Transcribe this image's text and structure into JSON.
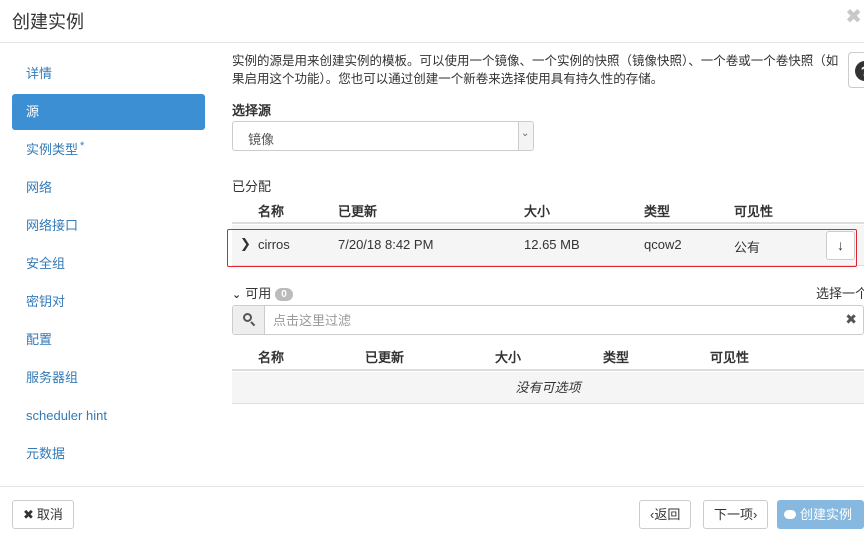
{
  "modal": {
    "title": "创建实例"
  },
  "sidebar": {
    "items": [
      {
        "label": "详情"
      },
      {
        "label": "源"
      },
      {
        "label": "实例类型",
        "required": "*"
      },
      {
        "label": "网络"
      },
      {
        "label": "网络接口"
      },
      {
        "label": "安全组"
      },
      {
        "label": "密钥对"
      },
      {
        "label": "配置"
      },
      {
        "label": "服务器组"
      },
      {
        "label": "scheduler hint"
      },
      {
        "label": "元数据"
      }
    ],
    "active_index": 1
  },
  "source": {
    "help_text": "实例的源是用来创建实例的模板。可以使用一个镜像、一个实例的快照（镜像快照）、一个卷或一个卷快照（如果启用这个功能）。您也可以通过创建一个新卷来选择使用具有持久性的存储。",
    "select_label": "选择源",
    "select_value": "镜像"
  },
  "allocated": {
    "label": "已分配",
    "columns": [
      "名称",
      "已更新",
      "大小",
      "类型",
      "可见性"
    ],
    "rows": [
      {
        "name": "cirros",
        "updated": "7/20/18 8:42 PM",
        "size": "12.65 MB",
        "type": "qcow2",
        "visibility": "公有"
      }
    ]
  },
  "available": {
    "label": "可用",
    "count": "0",
    "select_one": "选择一个",
    "filter_placeholder": "点击这里过滤",
    "columns": [
      "名称",
      "已更新",
      "大小",
      "类型",
      "可见性"
    ],
    "empty_text": "没有可选项"
  },
  "footer": {
    "cancel": "取消",
    "back": "‹返回",
    "next": "下一项›",
    "create": "创建实例"
  },
  "colors": {
    "active_nav": "#3d8fd3",
    "link": "#337ab7",
    "highlight_border": "#e0232e",
    "create_button": "#86b8e0"
  }
}
